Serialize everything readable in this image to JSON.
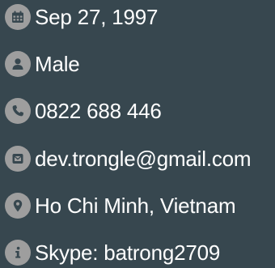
{
  "profile": {
    "colors": {
      "background": "#37474f",
      "icon_circle": "#9e9e9e",
      "icon_glyph": "#37474f",
      "text": "#ffffff"
    },
    "items": [
      {
        "icon": "calendar-icon",
        "text": "Sep 27, 1997"
      },
      {
        "icon": "user-icon",
        "text": "Male"
      },
      {
        "icon": "phone-icon",
        "text": "0822 688 446"
      },
      {
        "icon": "envelope-icon",
        "text": "dev.trongle@gmail.com"
      },
      {
        "icon": "map-marker-icon",
        "text": "Ho Chi Minh, Vietnam"
      },
      {
        "icon": "info-icon",
        "text": "Skype: batrong2709"
      }
    ]
  }
}
